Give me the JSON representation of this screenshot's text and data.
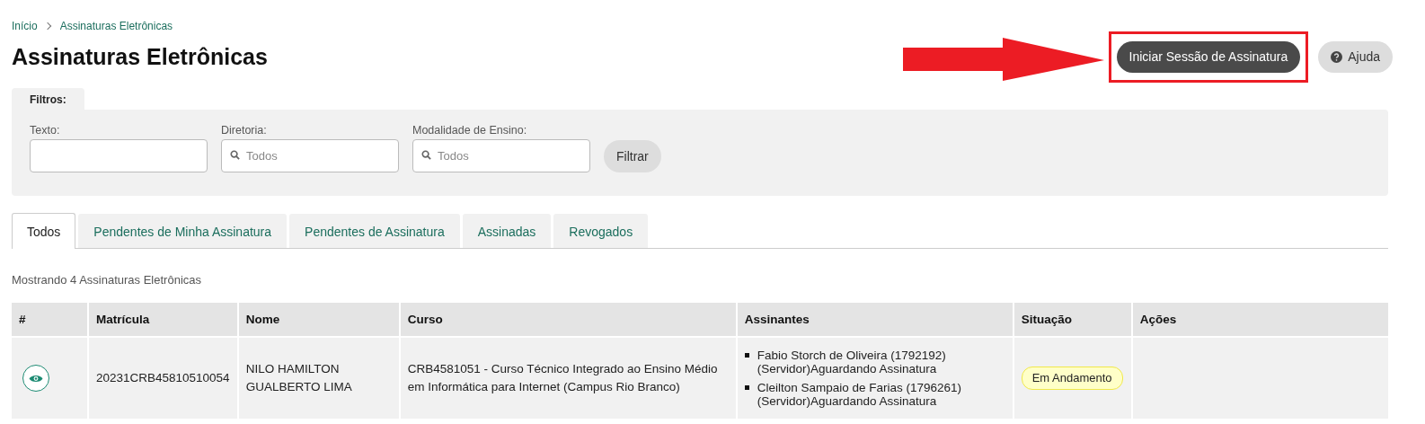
{
  "breadcrumb": [
    {
      "label": "Início"
    },
    {
      "label": "Assinaturas Eletrônicas"
    }
  ],
  "title": "Assinaturas Eletrônicas",
  "actions": [
    {
      "kind": "primary",
      "label": "Iniciar Sessão de Assinatura",
      "highlighted": true
    },
    {
      "kind": "help",
      "label": "Ajuda",
      "highlighted": false
    }
  ],
  "filters": {
    "tab_label": "Filtros:",
    "fields": [
      {
        "label": "Texto:",
        "kind": "text"
      },
      {
        "label": "Diretoria:",
        "kind": "search",
        "placeholder": "Todos"
      },
      {
        "label": "Modalidade de Ensino:",
        "kind": "search",
        "placeholder": "Todos"
      }
    ],
    "button": "Filtrar"
  },
  "tabs": [
    {
      "label": "Todos",
      "selected": true
    },
    {
      "label": "Pendentes de Minha Assinatura",
      "selected": false
    },
    {
      "label": "Pendentes de Assinatura",
      "selected": false
    },
    {
      "label": "Assinadas",
      "selected": false
    },
    {
      "label": "Revogados",
      "selected": false
    }
  ],
  "summary": "Mostrando 4 Assinaturas Eletrônicas",
  "table": {
    "columns": [
      "#",
      "Matrícula",
      "Nome",
      "Curso",
      "Assinantes",
      "Situação",
      "Ações"
    ],
    "rows": [
      {
        "matricula": "20231CRB45810510054",
        "nome": "NILO HAMILTON GUALBERTO LIMA",
        "curso": "CRB4581051 - Curso Técnico Integrado ao Ensino Médio em Informática para Internet (Campus Rio Branco)",
        "assinantes": [
          {
            "line1": "Fabio Storch de Oliveira (1792192)",
            "line2": "(Servidor)Aguardando Assinatura"
          },
          {
            "line1": "Cleilton Sampaio de Farias (1796261)",
            "line2": "(Servidor)Aguardando Assinatura"
          }
        ],
        "situacao": "Em Andamento"
      }
    ]
  }
}
